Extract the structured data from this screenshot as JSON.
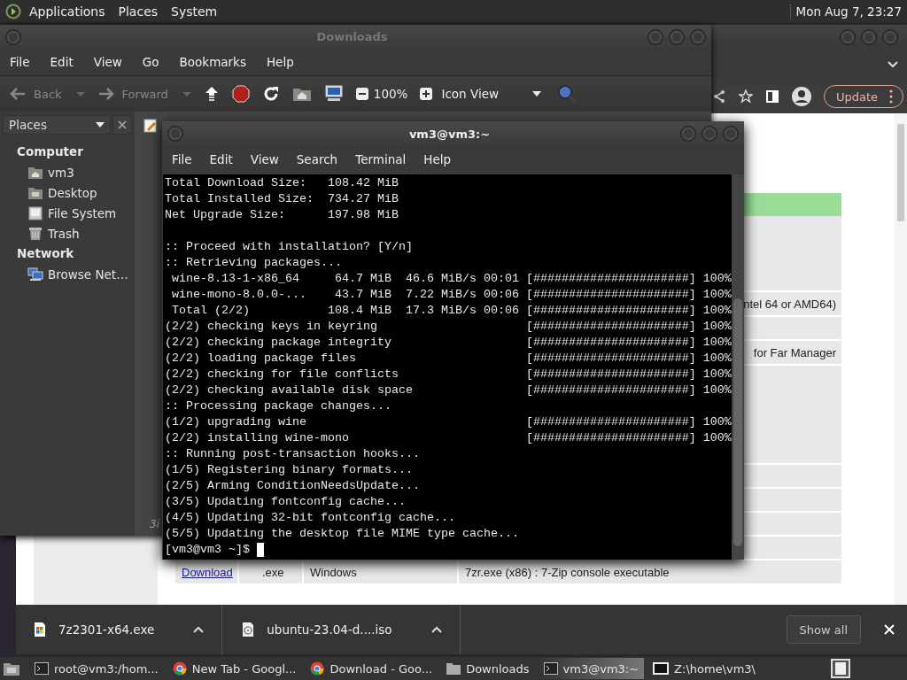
{
  "top_panel": {
    "menus": [
      "Applications",
      "Places",
      "System"
    ],
    "clock": "Mon Aug  7, 23:27"
  },
  "browser": {
    "update_button": "Update",
    "table_rows": [
      {
        "kind": "header"
      },
      {
        "kind": "tall"
      },
      {
        "kind": "tail",
        "text": "ntel 64 or AMD64)"
      },
      {
        "kind": "blank"
      },
      {
        "kind": "tail",
        "text": "for Far Manager"
      },
      {
        "kind": "taller"
      },
      {
        "kind": "blank"
      },
      {
        "kind": "blank"
      },
      {
        "kind": "blank"
      },
      {
        "kind": "blank"
      },
      {
        "kind": "full",
        "link": "Download",
        "ext": ".exe",
        "os": "Windows",
        "description": "7zr.exe (x86) : 7-Zip console executable"
      }
    ],
    "downloads": [
      {
        "name": "7z2301-x64.exe",
        "kind": "exe"
      },
      {
        "name": "ubuntu-23.04-d....iso",
        "kind": "iso"
      }
    ],
    "show_all": "Show all"
  },
  "file_manager": {
    "title": "Downloads",
    "menu": [
      "File",
      "Edit",
      "View",
      "Go",
      "Bookmarks",
      "Help"
    ],
    "back": {
      "label": "Back",
      "disabled": true
    },
    "forward": {
      "label": "Forward",
      "disabled": true
    },
    "zoom": "100%",
    "view_mode": "Icon View",
    "sidebar_title": "Places",
    "sections": [
      {
        "title": "Computer",
        "items": [
          {
            "label": "vm3",
            "kind": "home"
          },
          {
            "label": "Desktop",
            "kind": "desktop"
          },
          {
            "label": "File System",
            "kind": "drive"
          },
          {
            "label": "Trash",
            "kind": "trash"
          }
        ]
      },
      {
        "title": "Network",
        "items": [
          {
            "label": "Browse Net…",
            "kind": "network"
          }
        ]
      }
    ],
    "status": "3i"
  },
  "terminal": {
    "title": "vm3@vm3:~",
    "menu": [
      "File",
      "Edit",
      "View",
      "Search",
      "Terminal",
      "Help"
    ],
    "blocks": [
      {
        "lines": [
          {
            "text": "Total Download Size:   108.42 MiB"
          },
          {
            "text": "Total Installed Size:  734.27 MiB"
          },
          {
            "text": "Net Upgrade Size:      197.98 MiB"
          }
        ]
      },
      {
        "lines": [
          {
            "text": ":: Proceed with installation? [Y/n]"
          },
          {
            "text": ":: Retrieving packages..."
          },
          {
            "text": " wine-8.13-1-x86_64     64.7 MiB  46.6 MiB/s 00:01",
            "bar": "[######################]",
            "percent": "100%"
          },
          {
            "text": " wine-mono-8.0.0-...    43.7 MiB  7.22 MiB/s 00:06",
            "bar": "[######################]",
            "percent": "100%"
          },
          {
            "text": " Total (2/2)           108.4 MiB  17.3 MiB/s 00:06",
            "bar": "[######################]",
            "percent": "100%"
          },
          {
            "text": "(2/2) checking keys in keyring",
            "bar": "[######################]",
            "percent": "100%"
          },
          {
            "text": "(2/2) checking package integrity",
            "bar": "[######################]",
            "percent": "100%"
          },
          {
            "text": "(2/2) loading package files",
            "bar": "[######################]",
            "percent": "100%"
          },
          {
            "text": "(2/2) checking for file conflicts",
            "bar": "[######################]",
            "percent": "100%"
          },
          {
            "text": "(2/2) checking available disk space",
            "bar": "[######################]",
            "percent": "100%"
          },
          {
            "text": ":: Processing package changes..."
          },
          {
            "text": "(1/2) upgrading wine",
            "bar": "[######################]",
            "percent": "100%"
          },
          {
            "text": "(2/2) installing wine-mono",
            "bar": "[######################]",
            "percent": "100%"
          },
          {
            "text": ":: Running post-transaction hooks..."
          },
          {
            "text": "(1/5) Registering binary formats..."
          },
          {
            "text": "(2/5) Arming ConditionNeedsUpdate..."
          },
          {
            "text": "(3/5) Updating fontconfig cache..."
          },
          {
            "text": "(4/5) Updating 32-bit fontconfig cache..."
          },
          {
            "text": "(5/5) Updating the desktop file MIME type cache..."
          }
        ]
      }
    ],
    "prompt": "[vm3@vm3 ~]$"
  },
  "taskbar": {
    "tasks": [
      {
        "label": "root@vm3:/hom...",
        "kind": "terminal",
        "selected": false
      },
      {
        "label": "New Tab - Googl...",
        "kind": "chrome",
        "selected": false
      },
      {
        "label": "Download - Goo...",
        "kind": "chrome",
        "selected": false
      },
      {
        "label": "Downloads",
        "kind": "folder",
        "selected": false
      },
      {
        "label": "vm3@vm3:~",
        "kind": "terminal",
        "selected": true
      },
      {
        "label": "Z:\\home\\vm3\\",
        "kind": "wine",
        "selected": false
      }
    ]
  }
}
